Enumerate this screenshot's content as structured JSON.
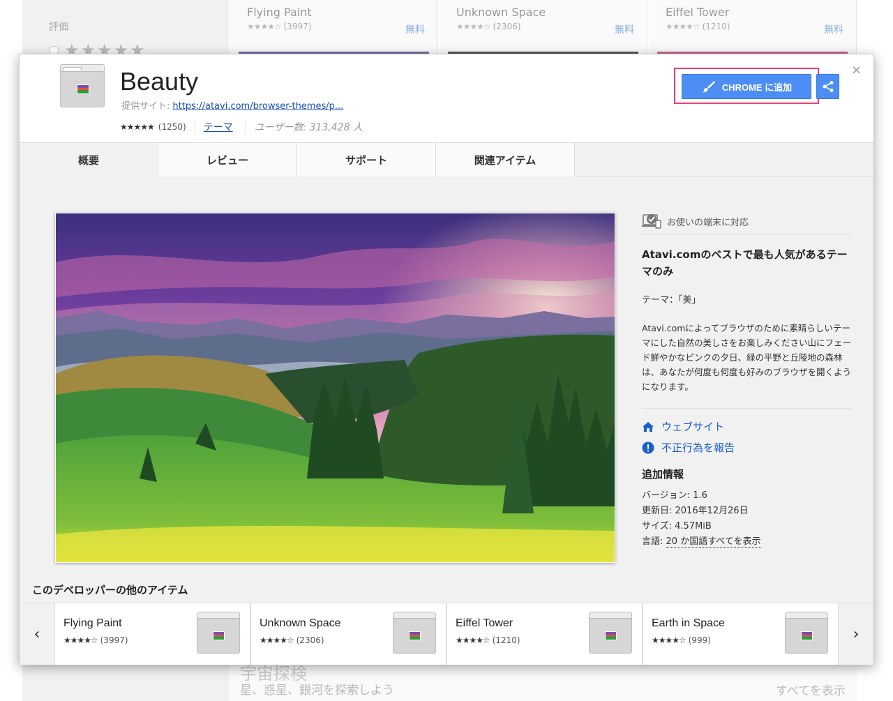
{
  "background": {
    "rating_label": "評価",
    "rating_stars": "★★★★★",
    "top_cards": [
      {
        "name": "Flying Paint",
        "stars": "★★★★☆",
        "count": "(3997)",
        "price": "無料"
      },
      {
        "name": "Unknown Space",
        "stars": "★★★★☆",
        "count": "(2306)",
        "price": "無料"
      },
      {
        "name": "Eiffel Tower",
        "stars": "★★★★☆",
        "count": "(1210)",
        "price": "無料"
      }
    ],
    "bottom_title": "宇宙探検",
    "bottom_subtitle": "星、惑星、銀河を探索しよう",
    "bottom_view_all": "すべてを表示"
  },
  "item": {
    "title": "Beauty",
    "provider_label": "提供サイト:",
    "provider_link": "https://atavi.com/browser-themes/p...",
    "stars": "★★★★★",
    "rating_count": "(1250)",
    "category": "テーマ",
    "users": "ユーザー数: 313,428 人"
  },
  "actions": {
    "add_button": "CHROME に追加",
    "share_icon": "share-icon",
    "close": "×"
  },
  "tabs": [
    {
      "label": "概要",
      "active": true
    },
    {
      "label": "レビュー",
      "active": false
    },
    {
      "label": "サポート",
      "active": false
    },
    {
      "label": "関連アイテム",
      "active": false
    }
  ],
  "details": {
    "compat": "お使いの端末に対応",
    "headline": "Atavi.comのベストで最も人気があるテーマのみ",
    "theme_line": "テーマ：「美」",
    "description": "Atavi.comによってブラウザのために素晴らしいテーマにした自然の美しさをお楽しみください山にフェード鮮やかなピンクの夕日、緑の平野と丘陵地の森林は、あなたが何度も何度も好みのブラウザを開くようになります。",
    "website": "ウェブサイト",
    "report": "不正行為を報告",
    "info_heading": "追加情報",
    "version": "バージョン: 1.6",
    "updated": "更新日: 2016年12月26日",
    "size": "サイズ: 4.57MiB",
    "language_label": "言語: ",
    "language_link": "20 か国語すべてを表示"
  },
  "more": {
    "title": "このデベロッパーの他のアイテム",
    "prev": "‹",
    "next": "›",
    "items": [
      {
        "name": "Flying Paint",
        "stars": "★★★★☆",
        "count": "(3997)"
      },
      {
        "name": "Unknown Space",
        "stars": "★★★★☆",
        "count": "(2306)"
      },
      {
        "name": "Eiffel Tower",
        "stars": "★★★★☆",
        "count": "(1210)"
      },
      {
        "name": "Earth in Space",
        "stars": "★★★★☆",
        "count": "(999)"
      }
    ]
  },
  "colors": {
    "accent": "#4d8ef4",
    "highlight": "#e83e7a",
    "link": "#1a5fcc"
  }
}
